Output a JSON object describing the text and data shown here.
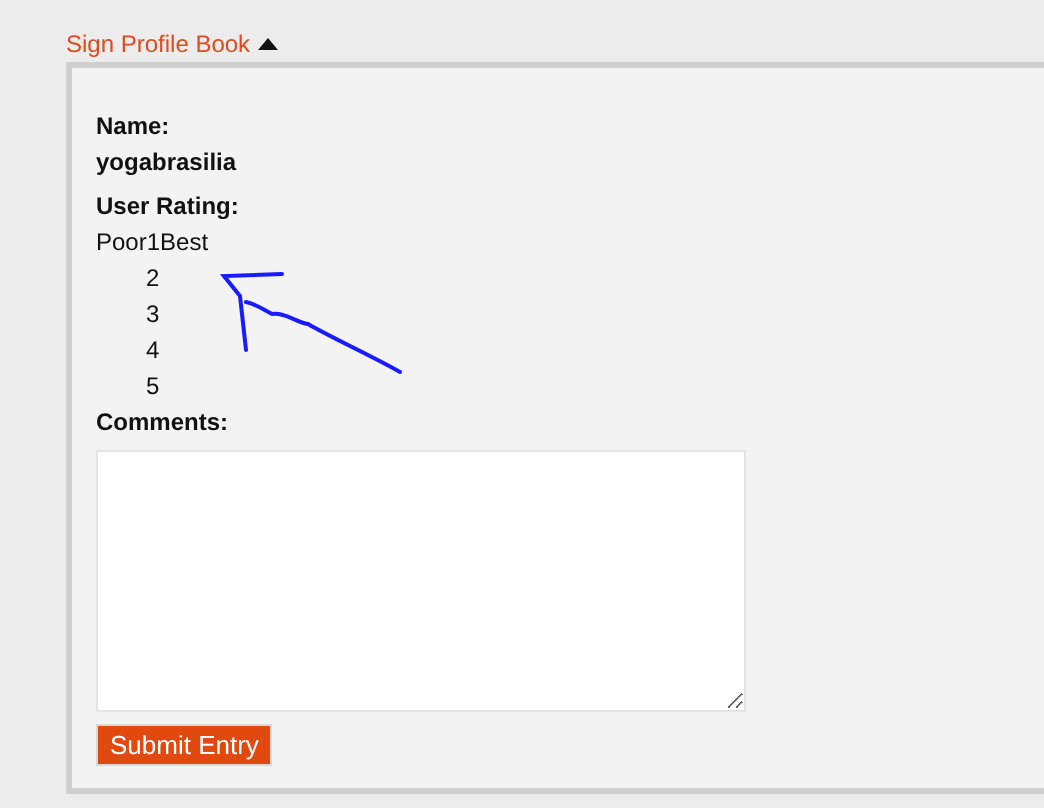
{
  "section": {
    "title": "Sign Profile Book",
    "expanded": true
  },
  "form": {
    "name_label": "Name:",
    "name_value": "yogabrasilia",
    "rating_label": "User Rating:",
    "rating": {
      "low_label": "Poor",
      "high_label": "Best",
      "options": [
        "1",
        "2",
        "3",
        "4",
        "5"
      ]
    },
    "comments_label": "Comments:",
    "submit": "Submit Entry"
  },
  "annotation": {
    "kind": "arrow"
  }
}
